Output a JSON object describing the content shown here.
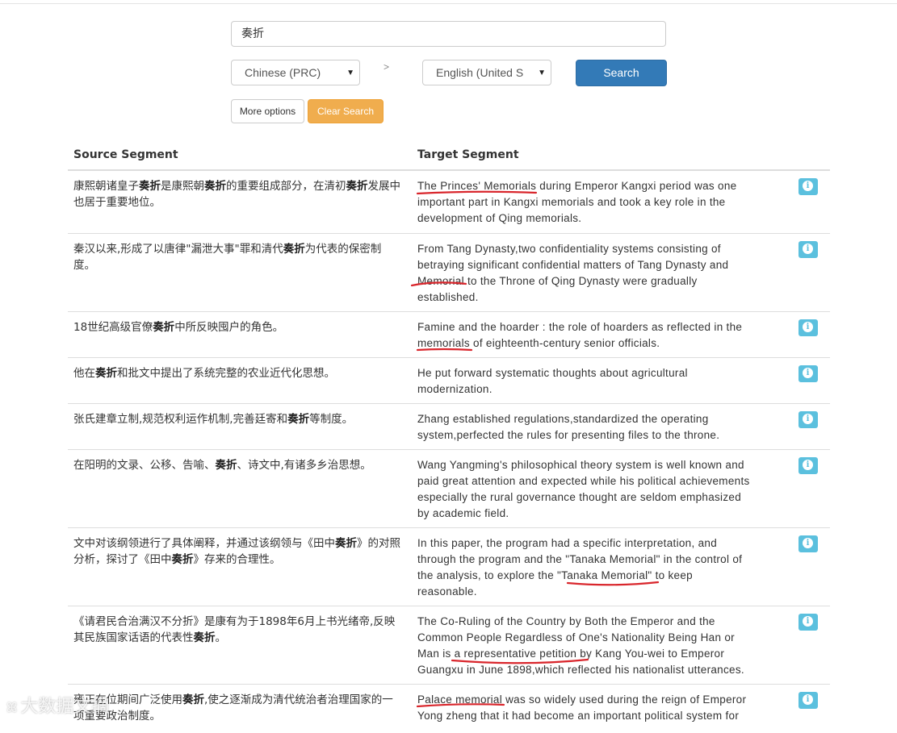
{
  "search": {
    "query": "奏折"
  },
  "languages": {
    "source": "Chinese (PRC)",
    "separator": ">",
    "target": "English (United S"
  },
  "buttons": {
    "search": "Search",
    "more_options": "More options",
    "clear_search": "Clear Search"
  },
  "table": {
    "headers": {
      "source": "Source Segment",
      "target": "Target Segment"
    },
    "rows": [
      {
        "source": [
          "康熙朝诸皇子",
          "奏折",
          "是康熙朝",
          "奏折",
          "的重要组成部分，在清初",
          "奏折",
          "发展中也居于重要地位。"
        ],
        "target": "The Princes' Memorials during Emperor Kangxi period was one important part in Kangxi memorials and took a key role in the development of Qing memorials."
      },
      {
        "source": [
          "秦汉以来,形成了以唐律\"漏泄大事\"罪和清代",
          "奏折",
          "为代表的保密制度。"
        ],
        "target": "From Tang Dynasty,two confidentiality systems consisting of betraying significant confidential matters of Tang Dynasty and Memorial to the Throne of Qing Dynasty were gradually established."
      },
      {
        "source": [
          "18世纪高级官僚",
          "奏折",
          "中所反映囤户的角色。"
        ],
        "target": "Famine and the hoarder : the role of hoarders as reflected in the memorials of eighteenth-century senior officials."
      },
      {
        "source": [
          "他在",
          "奏折",
          "和批文中提出了系统完整的农业近代化思想。"
        ],
        "target": "He put forward systematic thoughts about agricultural modernization."
      },
      {
        "source": [
          "张氏建章立制,规范权利运作机制,完善廷寄和",
          "奏折",
          "等制度。"
        ],
        "target": "Zhang established regulations,standardized the operating system,perfected the rules for presenting files to the throne."
      },
      {
        "source": [
          "在阳明的文录、公移、告喻、",
          "奏折",
          "、诗文中,有诸多乡治思想。"
        ],
        "target": "Wang Yangming's philosophical theory system is well known and paid great attention and expected while his political achievements especially the rural governance thought are seldom emphasized by academic field."
      },
      {
        "source": [
          "文中对该纲领进行了具体阐释，并通过该纲领与《田中",
          "奏折",
          "》的对照分析，探讨了《田中",
          "奏折",
          "》存来的合理性。"
        ],
        "target": "In this paper, the program had a specific interpretation, and through the program and the \"Tanaka Memorial\" in the control of the analysis, to explore the \"Tanaka Memorial\" to keep reasonable."
      },
      {
        "source": [
          "《请君民合治满汉不分折》是康有为于1898年6月上书光绪帝,反映其民族国家话语的代表性",
          "奏折",
          "。"
        ],
        "target": "The Co-Ruling of the Country by Both the Emperor and the Common People Regardless of One's Nationality Being Han or Man is a representative petition by Kang You-wei to Emperor Guangxu in June 1898,which reflected his nationalist utterances."
      },
      {
        "source": [
          "雍正在位期间广泛使用",
          "奏折",
          ",使之逐渐成为清代统治者治理国家的一项重要政治制度。"
        ],
        "target": "Palace memorial was so widely used during the reign of Emperor Yong zheng that it had become an important political system for"
      }
    ]
  },
  "watermark": {
    "text": "大数据文摘",
    "logo": "ꕤ"
  },
  "colors": {
    "primary": "#337ab7",
    "warning": "#f0ad4e",
    "info": "#5bc0de",
    "annotation": "#d9262c"
  }
}
